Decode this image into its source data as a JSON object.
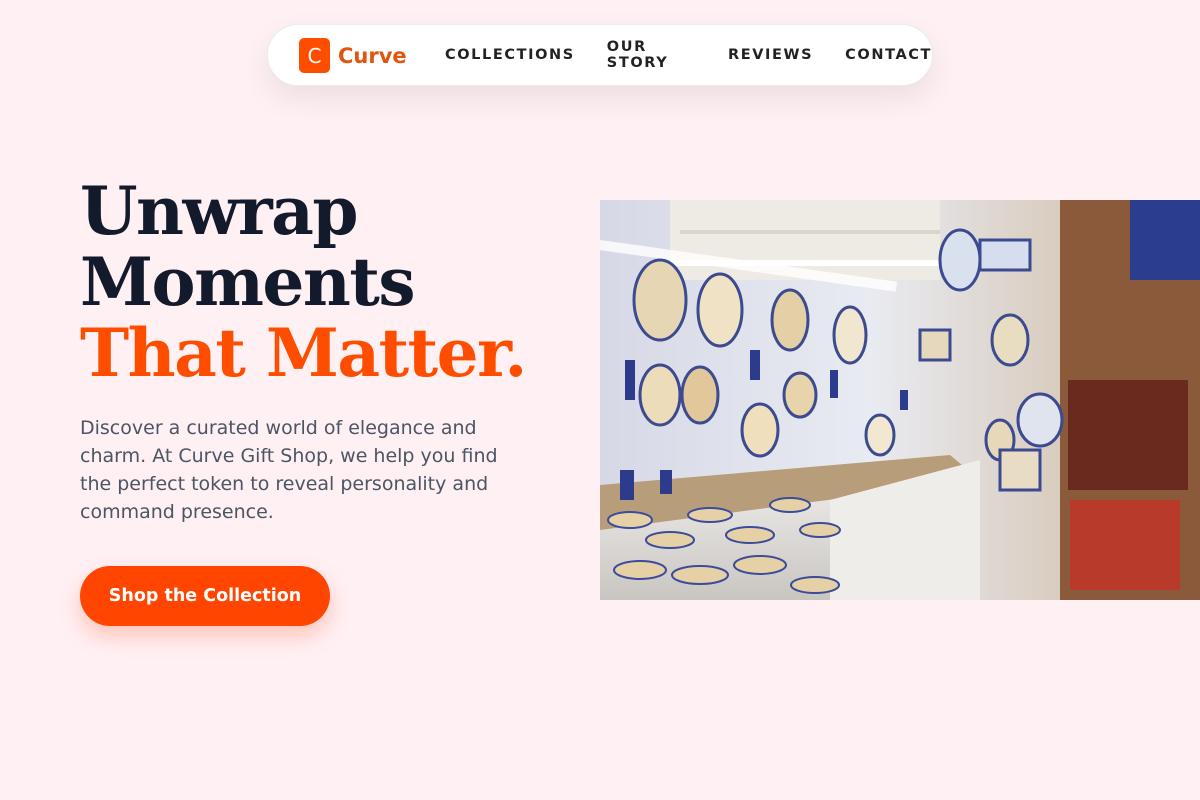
{
  "brand": {
    "logo_letter": "C",
    "name": "Curve"
  },
  "nav": {
    "links": [
      "COLLECTIONS",
      "OUR STORY",
      "REVIEWS",
      "CONTACT"
    ]
  },
  "hero": {
    "title_line1": "Unwrap",
    "title_line2": "Moments",
    "title_accent": "That Matter.",
    "lead": "Discover a curated world of elegance and charm. At Curve Gift Shop, we help you find the perfect token to reveal personality and command presence.",
    "cta_label": "Shop the Collection"
  },
  "colors": {
    "accent": "#FF4D00",
    "background": "#FFF0F4",
    "heading": "#131A2B",
    "body_text": "#4B5563"
  },
  "image": {
    "subject": "ceramic-plates-shop-photo"
  }
}
